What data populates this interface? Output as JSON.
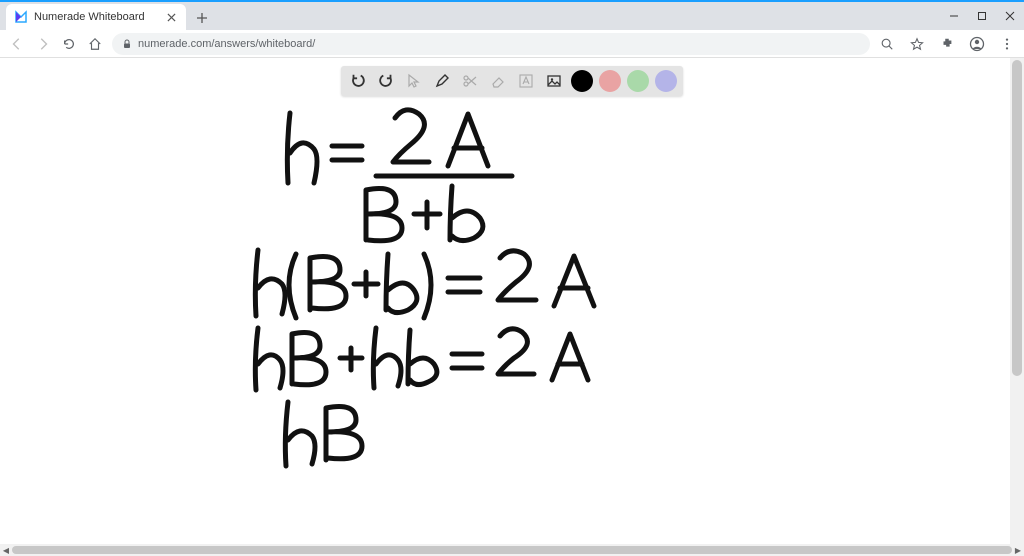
{
  "browser": {
    "tab_title": "Numerade Whiteboard",
    "url_display": "numerade.com/answers/whiteboard/"
  },
  "toolbar": {
    "tools": {
      "undo": "undo",
      "redo": "redo",
      "pointer": "pointer",
      "pen": "pen",
      "scissors": "scissors",
      "eraser": "eraser",
      "text": "text",
      "image": "image"
    },
    "swatches": {
      "black": "#000000",
      "pink": "#e9a3a3",
      "green": "#a9d9a9",
      "blue": "#b4b4e8"
    }
  },
  "whiteboard": {
    "lines": [
      "h = 2A / (B + b)",
      "h(B + b) = 2A",
      "hB + hb = 2A",
      "hB"
    ]
  }
}
